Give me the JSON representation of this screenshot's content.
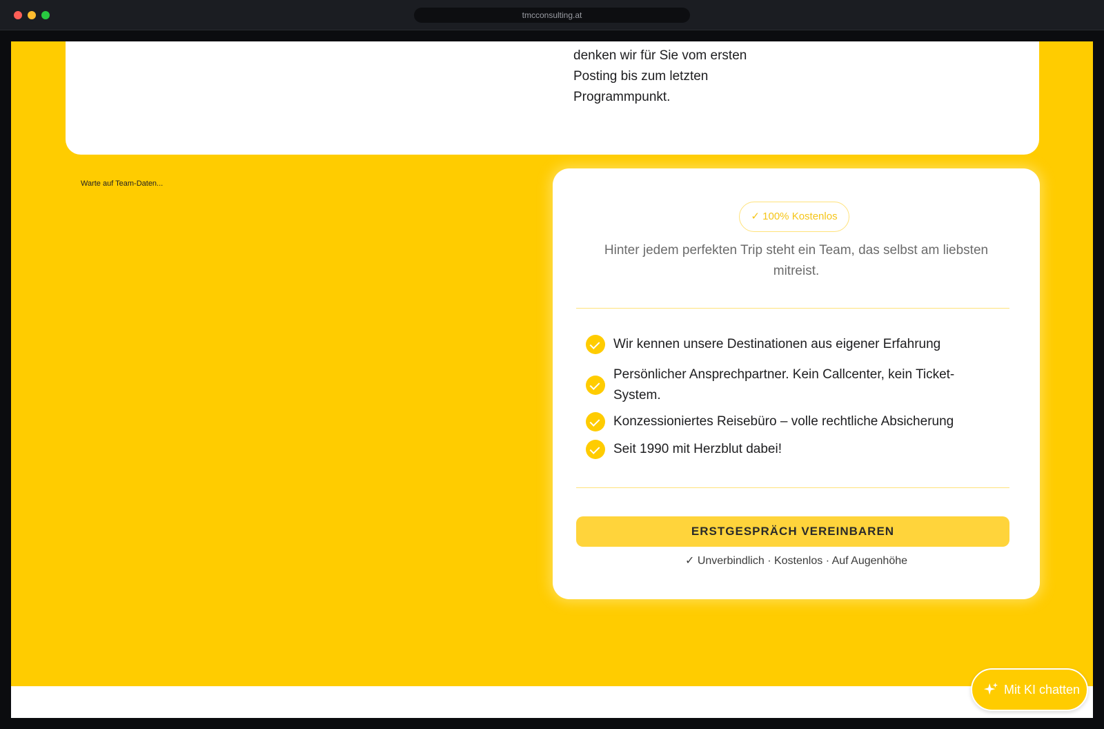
{
  "browser": {
    "url": "tmcconsulting.at"
  },
  "top_card": {
    "text_lines": [
      "denken wir für Sie vom ersten",
      "Posting bis zum letzten",
      "Programmpunkt."
    ]
  },
  "team": {
    "loading_text": "Warte auf Team-Daten..."
  },
  "offer": {
    "badge": "✓ 100% Kostenlos",
    "intro": "Hinter jedem perfekten Trip steht ein Team, das selbst am liebsten mitreist.",
    "features": [
      "Wir kennen unsere Destinationen aus eigener Erfahrung",
      "Persönlicher Ansprechpartner. Kein Callcenter, kein Ticket-System.",
      "Konzessioniertes Reisebüro – volle rechtliche Absicherung",
      "Seit 1990 mit Herzblut dabei!"
    ],
    "cta_label": "ERSTGESPRÄCH VEREINBAREN",
    "cta_note": "✓ Unverbindlich · Kostenlos · Auf Augenhöhe"
  },
  "chat": {
    "label": "Mit KI chatten",
    "icon": "sparkle-icon"
  },
  "colors": {
    "brand_yellow": "#ffcc00",
    "button_yellow": "#ffd43b",
    "titlebar": "#1b1d22"
  }
}
